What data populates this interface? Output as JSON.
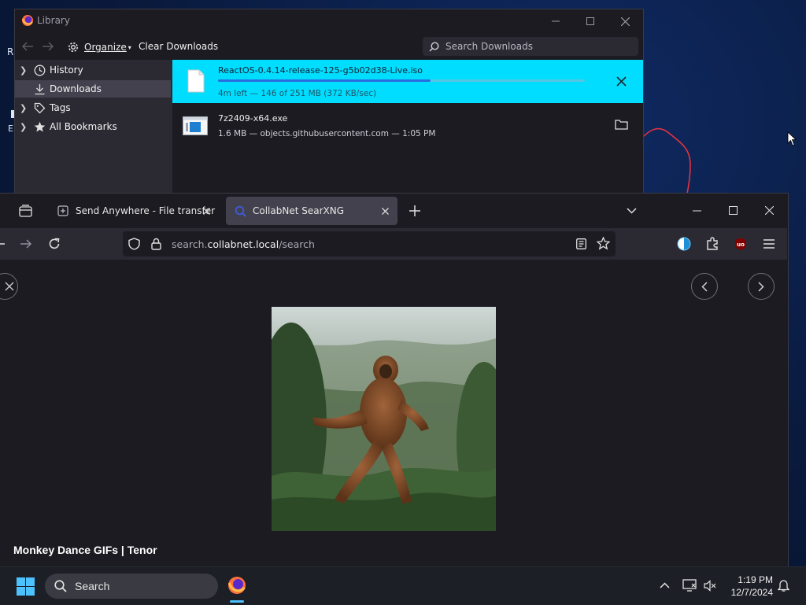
{
  "desktop": {
    "fragments": [
      "R",
      "E"
    ]
  },
  "library": {
    "title": "Library",
    "toolbar": {
      "organize_label": "Organize",
      "clear_label": "Clear Downloads",
      "search_placeholder": "Search Downloads"
    },
    "sidebar": {
      "items": [
        {
          "label": "History",
          "icon": "clock-icon",
          "expandable": true
        },
        {
          "label": "Downloads",
          "icon": "download-icon",
          "expandable": false,
          "selected": true
        },
        {
          "label": "Tags",
          "icon": "tag-icon",
          "expandable": true
        },
        {
          "label": "All Bookmarks",
          "icon": "star-icon",
          "expandable": true
        }
      ]
    },
    "downloads": [
      {
        "name": "ReactOS-0.4.14-release-125-g5b02d38-Live.iso",
        "status": "4m left — 146 of 251 MB (372 KB/sec)",
        "progress": 0.58,
        "icon": "file-icon",
        "action": "cancel-icon"
      },
      {
        "name": "7z2409-x64.exe",
        "status": "1.6 MB — objects.githubusercontent.com — 1:05 PM",
        "icon": "exe-file-icon",
        "action": "folder-icon"
      }
    ]
  },
  "browser": {
    "tabs": [
      {
        "title": "Send Anywhere - File transfer",
        "active": false
      },
      {
        "title": "CollabNet SearXNG",
        "active": true
      }
    ],
    "url": {
      "prefix": "search.",
      "domain": "collabnet.local",
      "path": "/search"
    },
    "image": {
      "caption": "Monkey Dance GIFs | Tenor"
    }
  },
  "taskbar": {
    "search_label": "Search",
    "time": "1:19 PM",
    "date": "12/7/2024"
  },
  "colors": {
    "accent": "#00ddff",
    "progress": "#2a6be0",
    "window_bg": "#1c1b22",
    "toolbar_bg": "#2b2a33"
  }
}
